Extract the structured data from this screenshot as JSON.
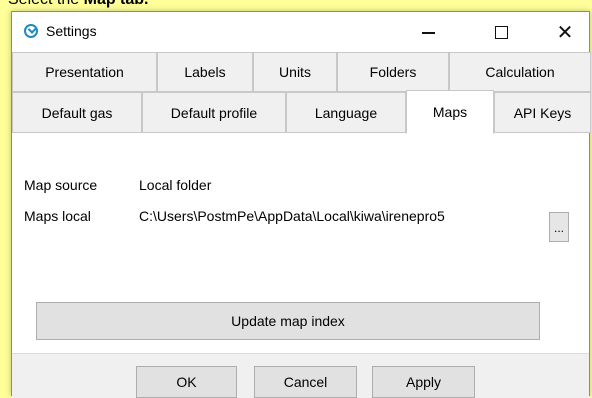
{
  "instruction": {
    "prefix": "Select the ",
    "bold": "Map tab."
  },
  "window": {
    "title": "Settings",
    "minimize_glyph": "—",
    "maximize_glyph": "☐",
    "close_glyph": "✕"
  },
  "tabs": {
    "row1": [
      "Presentation",
      "Labels",
      "Units",
      "Folders",
      "Calculation"
    ],
    "row2": [
      "Default gas",
      "Default profile",
      "Language",
      "Maps",
      "API Keys"
    ],
    "active": "Maps"
  },
  "maps": {
    "source_label": "Map source",
    "source_value": "Local folder",
    "local_label": "Maps local",
    "local_value": "C:\\Users\\PostmPe\\AppData\\Local\\kiwa\\irenepro5",
    "browse_label": "...",
    "update_button": "Update map index"
  },
  "footer": {
    "ok": "OK",
    "cancel": "Cancel",
    "apply": "Apply"
  },
  "colors": {
    "page_background": "#ffff99",
    "accent": "#1e88c8"
  }
}
